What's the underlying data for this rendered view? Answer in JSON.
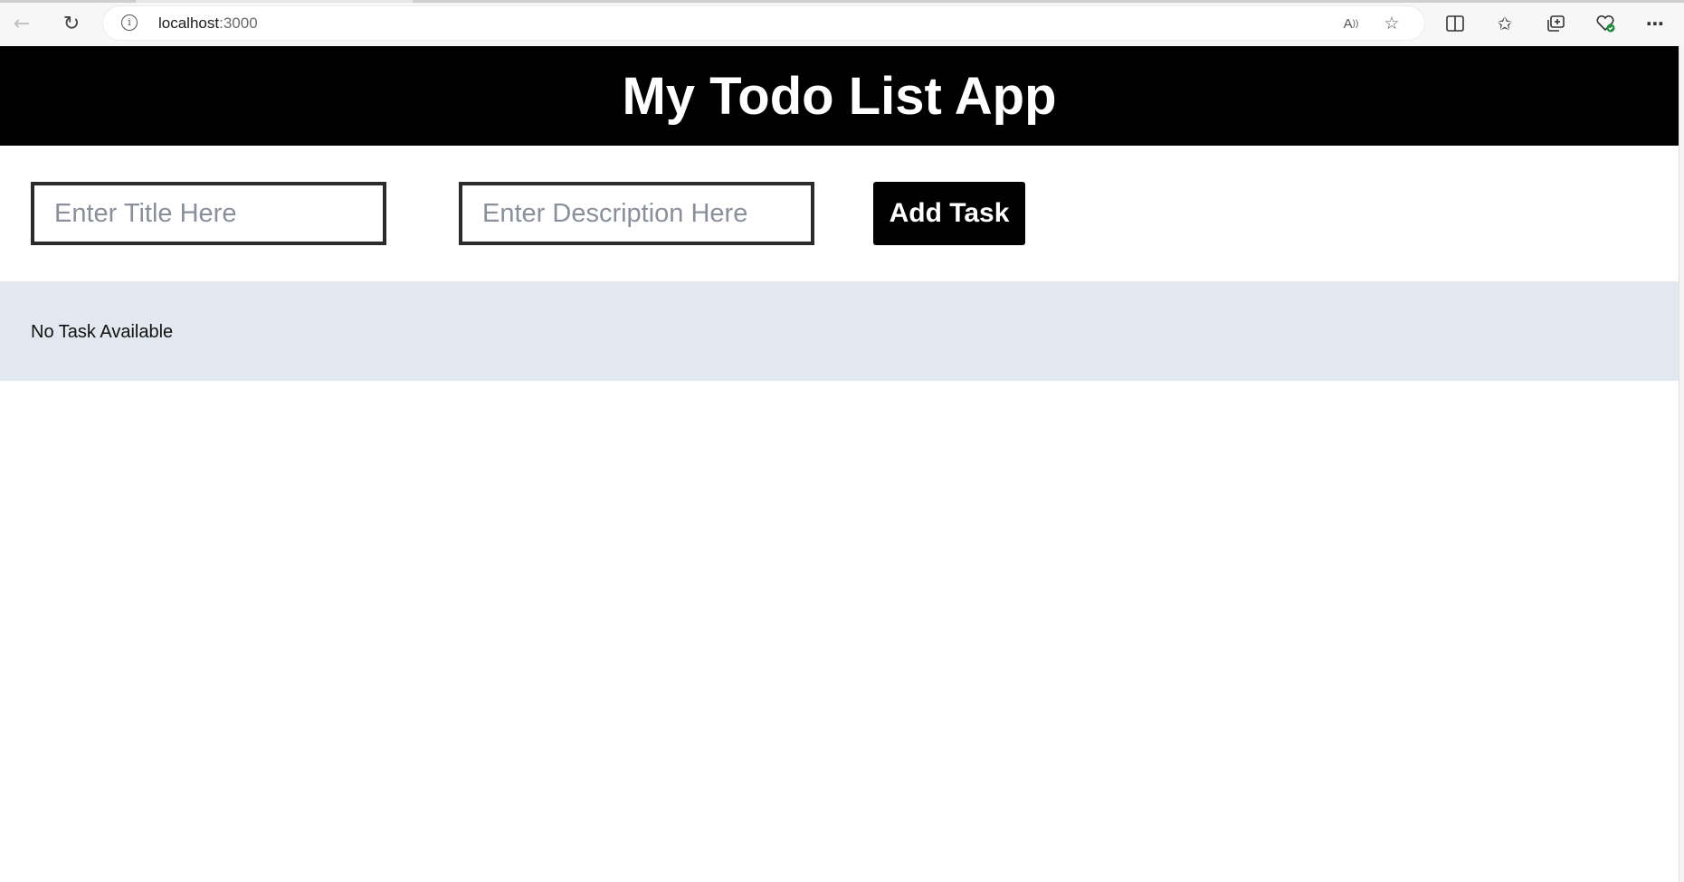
{
  "browser": {
    "url_host": "localhost",
    "url_port": ":3000",
    "icons": {
      "back": "back-arrow-icon",
      "refresh": "refresh-icon",
      "info": "site-info-icon",
      "read_aloud": "read-aloud-icon",
      "favorite": "favorite-star-icon",
      "split_screen": "split-screen-icon",
      "favorites": "favorites-list-icon",
      "collections": "collections-icon",
      "browser_essentials": "browser-essentials-icon",
      "more": "more-menu-icon"
    }
  },
  "app": {
    "title": "My Todo List App",
    "title_input": {
      "value": "",
      "placeholder": "Enter Title Here"
    },
    "description_input": {
      "value": "",
      "placeholder": "Enter Description Here"
    },
    "add_button_label": "Add Task",
    "empty_message": "No Task Available"
  },
  "colors": {
    "header_bg": "#000000",
    "header_text": "#ffffff",
    "button_bg": "#000000",
    "task_area_bg": "#e2e8f0",
    "input_border": "#2b2b2b"
  }
}
